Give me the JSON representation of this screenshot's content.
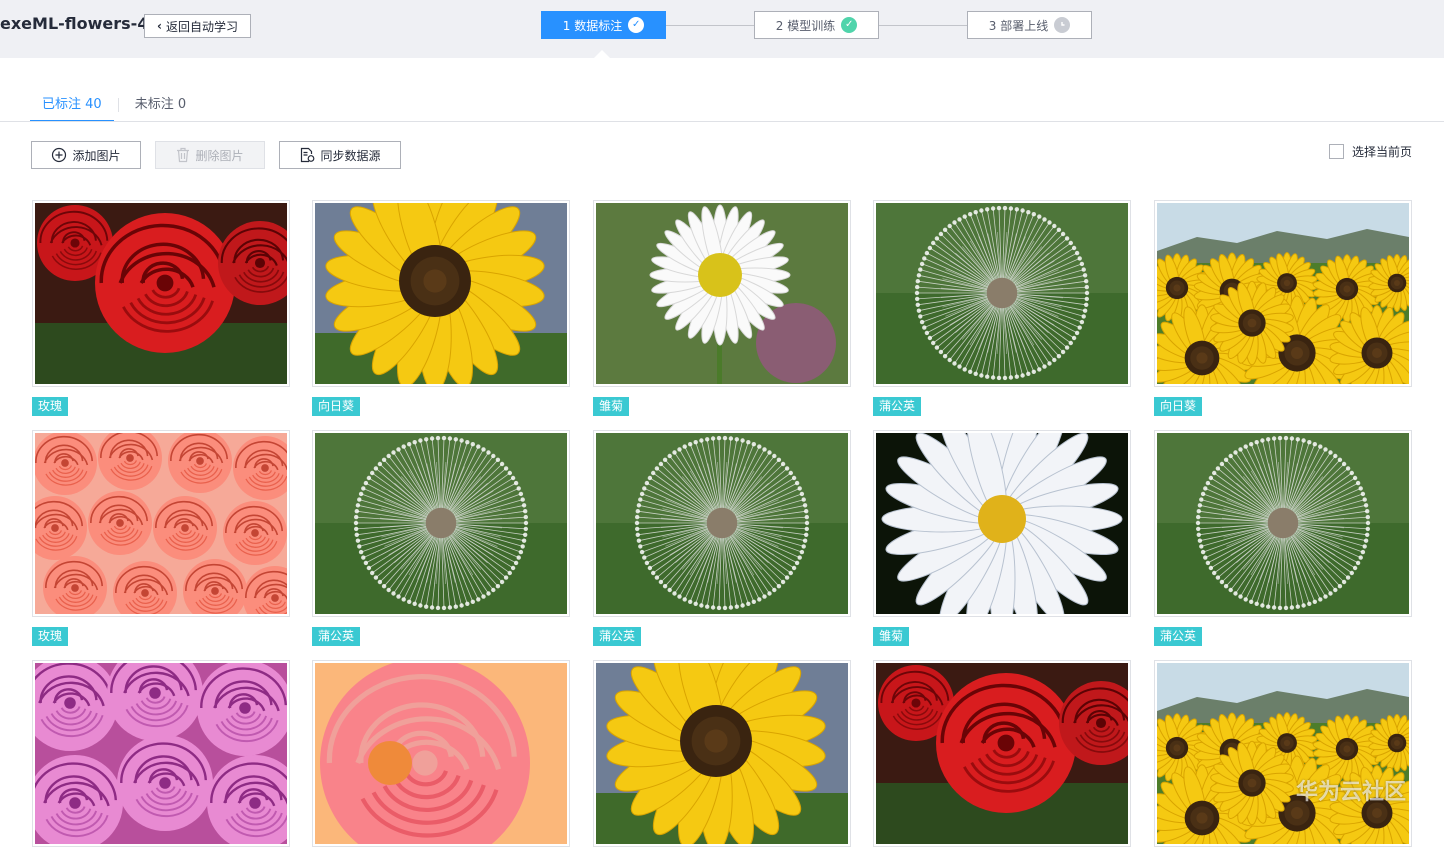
{
  "header": {
    "project_title": "exeML-flowers-4",
    "back_label": "返回自动学习",
    "steps": [
      {
        "label": "1 数据标注",
        "state": "active"
      },
      {
        "label": "2 模型训练",
        "state": "done"
      },
      {
        "label": "3 部署上线",
        "state": "pending"
      }
    ]
  },
  "tabs": [
    {
      "label": "已标注 40",
      "active": true
    },
    {
      "label": "未标注 0",
      "active": false
    }
  ],
  "toolbar": {
    "add_label": "添加图片",
    "delete_label": "删除图片",
    "sync_label": "同步数据源",
    "select_page_label": "选择当前页"
  },
  "colors": {
    "accent": "#2891ff",
    "tag": "#3ac9d2",
    "done": "#50d4ab"
  },
  "images": [
    {
      "tag": "玫瑰",
      "kind": "rose-red"
    },
    {
      "tag": "向日葵",
      "kind": "sunflower"
    },
    {
      "tag": "雏菊",
      "kind": "daisy"
    },
    {
      "tag": "蒲公英",
      "kind": "dandelion"
    },
    {
      "tag": "向日葵",
      "kind": "sunflower-field"
    },
    {
      "tag": "玫瑰",
      "kind": "rose-pink-bunch"
    },
    {
      "tag": "蒲公英",
      "kind": "dandelion"
    },
    {
      "tag": "蒲公英",
      "kind": "dandelion"
    },
    {
      "tag": "雏菊",
      "kind": "daisy-dark"
    },
    {
      "tag": "蒲公英",
      "kind": "dandelion"
    },
    {
      "tag": "",
      "kind": "rose-magenta"
    },
    {
      "tag": "",
      "kind": "rose-coral"
    },
    {
      "tag": "",
      "kind": "sunflower"
    },
    {
      "tag": "",
      "kind": "rose-red"
    },
    {
      "tag": "",
      "kind": "sunflower-field"
    }
  ],
  "watermark": "华为云社区"
}
